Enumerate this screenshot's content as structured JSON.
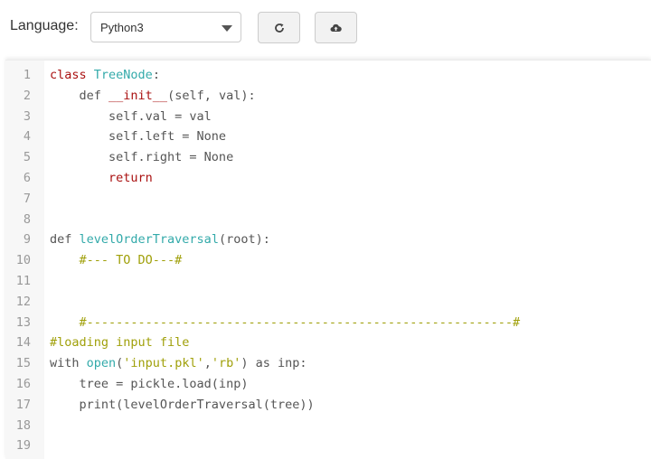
{
  "toolbar": {
    "language_label": "Language:",
    "language_selected": "Python3",
    "reload_icon": "reload-icon",
    "upload_icon": "cloud-upload-icon"
  },
  "editor": {
    "lines": [
      {
        "n": "1",
        "tokens": [
          {
            "t": "class ",
            "c": "t-ret"
          },
          {
            "t": "TreeNode",
            "c": "t-class"
          },
          {
            "t": ":",
            "c": "t-plain"
          }
        ]
      },
      {
        "n": "2",
        "tokens": [
          {
            "t": "    def ",
            "c": "t-plain"
          },
          {
            "t": "__init__",
            "c": "t-ret"
          },
          {
            "t": "(self, val):",
            "c": "t-plain"
          }
        ]
      },
      {
        "n": "3",
        "tokens": [
          {
            "t": "        self.val = val",
            "c": "t-plain"
          }
        ]
      },
      {
        "n": "4",
        "tokens": [
          {
            "t": "        self.left = None",
            "c": "t-plain"
          }
        ]
      },
      {
        "n": "5",
        "tokens": [
          {
            "t": "        self.right = None",
            "c": "t-plain"
          }
        ]
      },
      {
        "n": "6",
        "tokens": [
          {
            "t": "        ",
            "c": "t-plain"
          },
          {
            "t": "return",
            "c": "t-ret"
          }
        ]
      },
      {
        "n": "7",
        "tokens": []
      },
      {
        "n": "8",
        "tokens": []
      },
      {
        "n": "9",
        "tokens": [
          {
            "t": "def ",
            "c": "t-plain"
          },
          {
            "t": "levelOrderTraversal",
            "c": "t-class"
          },
          {
            "t": "(root):",
            "c": "t-plain"
          }
        ]
      },
      {
        "n": "10",
        "tokens": [
          {
            "t": "    #--- TO DO---#",
            "c": "t-comment"
          }
        ]
      },
      {
        "n": "11",
        "tokens": []
      },
      {
        "n": "12",
        "tokens": []
      },
      {
        "n": "13",
        "tokens": [
          {
            "t": "    #----------------------------------------------------------#",
            "c": "t-comment"
          }
        ]
      },
      {
        "n": "14",
        "tokens": [
          {
            "t": "#loading input file",
            "c": "t-comment"
          }
        ]
      },
      {
        "n": "15",
        "tokens": [
          {
            "t": "with ",
            "c": "t-plain"
          },
          {
            "t": "open",
            "c": "t-class"
          },
          {
            "t": "(",
            "c": "t-plain"
          },
          {
            "t": "'input.pkl'",
            "c": "t-comment"
          },
          {
            "t": ",",
            "c": "t-plain"
          },
          {
            "t": "'rb'",
            "c": "t-comment"
          },
          {
            "t": ") as inp:",
            "c": "t-plain"
          }
        ]
      },
      {
        "n": "16",
        "tokens": [
          {
            "t": "    tree = pickle.load(inp)",
            "c": "t-plain"
          }
        ]
      },
      {
        "n": "17",
        "tokens": [
          {
            "t": "    print(levelOrderTraversal(tree))",
            "c": "t-plain"
          }
        ]
      },
      {
        "n": "18",
        "tokens": []
      },
      {
        "n": "19",
        "tokens": []
      }
    ]
  }
}
